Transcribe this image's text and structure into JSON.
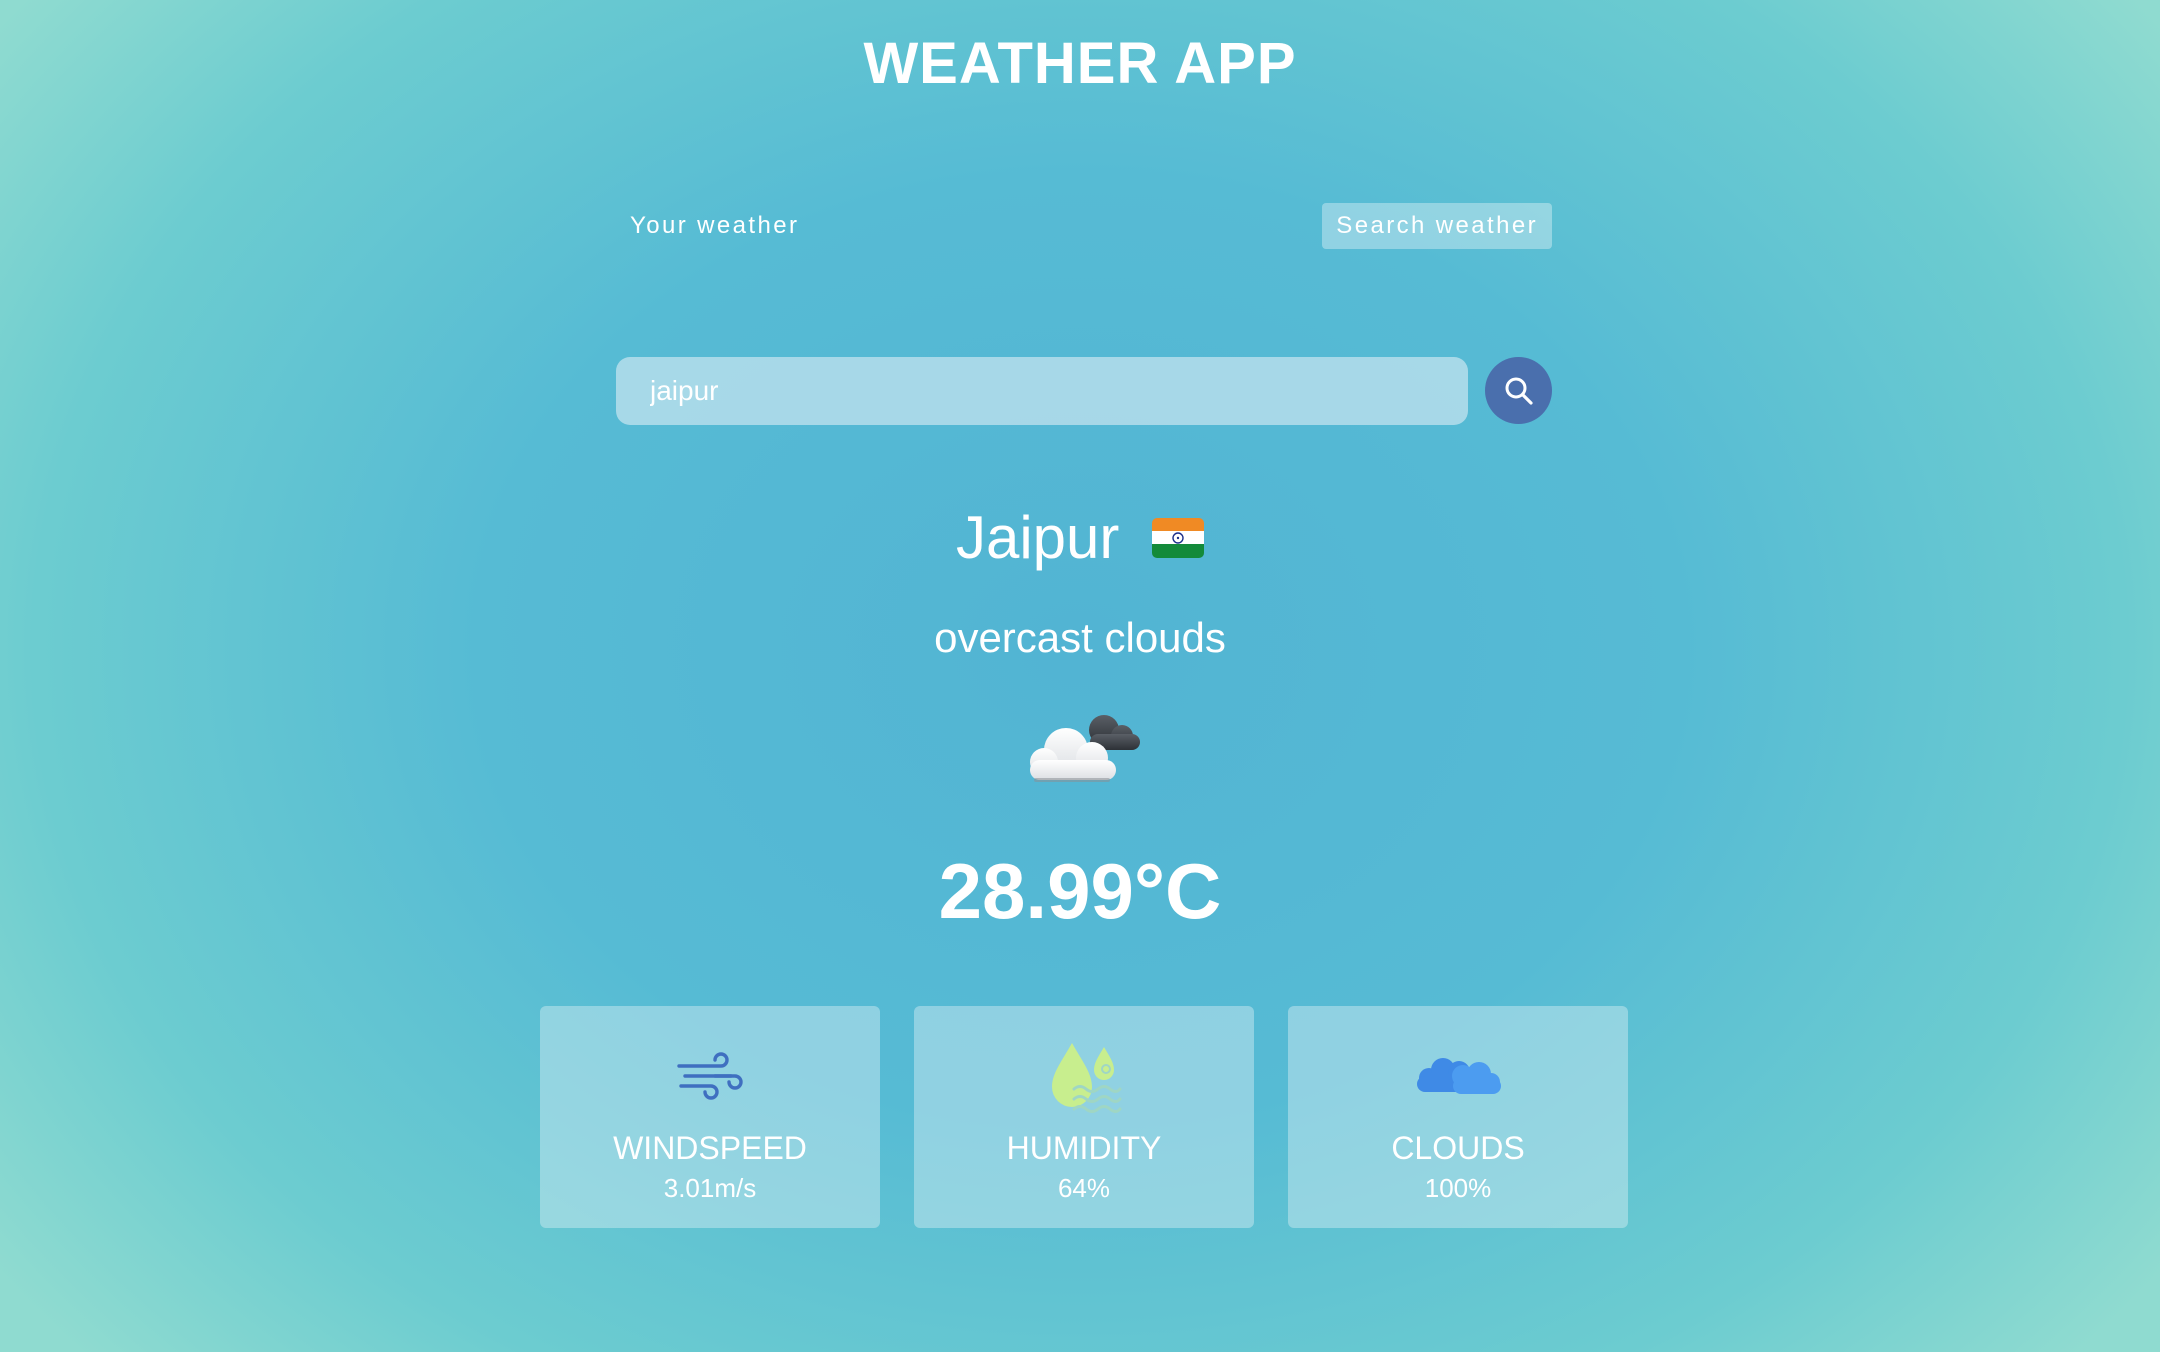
{
  "app": {
    "title": "WEATHER APP"
  },
  "tabs": {
    "your_weather": "Your weather",
    "search_weather": "Search weather"
  },
  "search": {
    "value": "jaipur"
  },
  "weather": {
    "city": "Jaipur",
    "country_flag": "india-flag-icon",
    "description": "overcast clouds",
    "icon": "overcast-clouds-icon",
    "temperature": "28.99°C"
  },
  "cards": [
    {
      "label": "WINDSPEED",
      "value": "3.01m/s",
      "icon": "wind-icon"
    },
    {
      "label": "HUMIDITY",
      "value": "64%",
      "icon": "humidity-icon"
    },
    {
      "label": "CLOUDS",
      "value": "100%",
      "icon": "cloud-icon"
    }
  ],
  "colors": {
    "search_button": "#4a6fad",
    "wind_icon": "#3f6fc0",
    "humidity_icon": "#c8ee8e",
    "cloud_icon": "#3f8ae6"
  }
}
